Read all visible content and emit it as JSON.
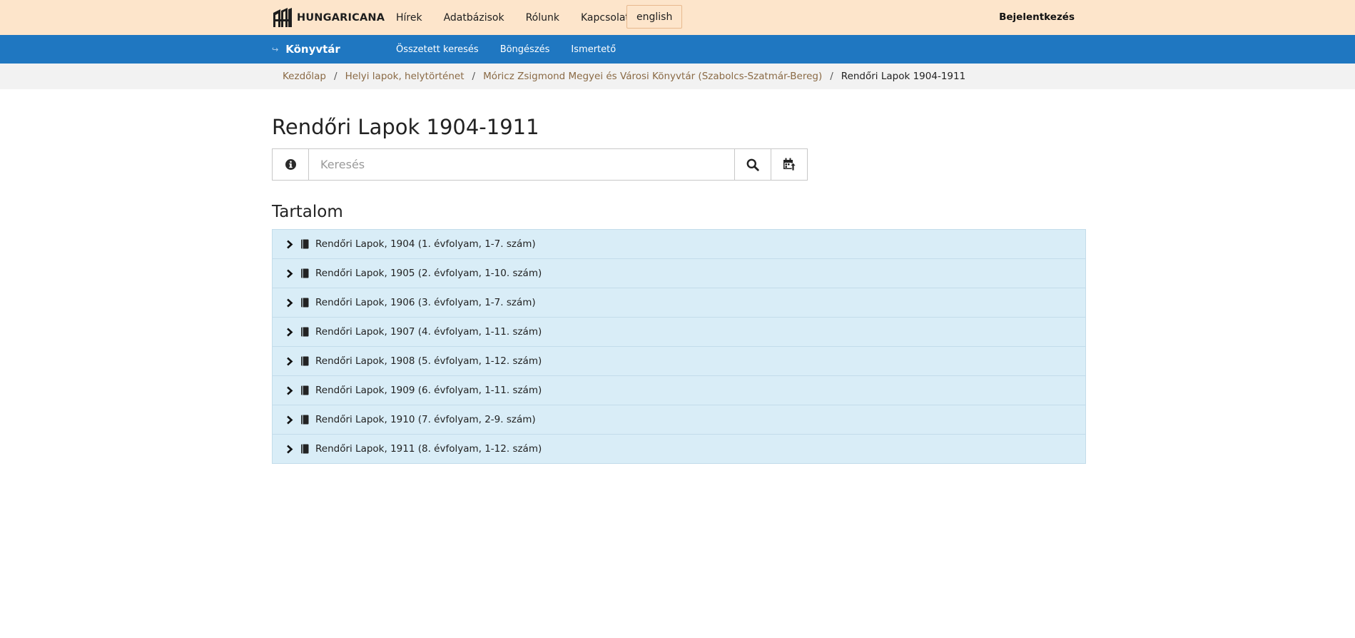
{
  "header": {
    "logo_text": "HUNGARICANA",
    "nav": [
      "Hírek",
      "Adatbázisok",
      "Rólunk",
      "Kapcsolat"
    ],
    "language_button": "english",
    "login_label": "Bejelentkezés"
  },
  "subheader": {
    "section_title": "Könyvtár",
    "section_icon": "sign-in-icon",
    "nav": [
      "Összetett keresés",
      "Böngészés",
      "Ismertető"
    ]
  },
  "breadcrumb": {
    "items": [
      "Kezdőlap",
      "Helyi lapok, helytörténet",
      "Móricz Zsigmond Megyei és Városi Könyvtár (Szabolcs-Szatmár-Bereg)"
    ],
    "separator": "/",
    "current": "Rendőri Lapok 1904-1911"
  },
  "page": {
    "title": "Rendőri Lapok 1904-1911"
  },
  "search": {
    "placeholder": "Keresés",
    "value": "",
    "icons": [
      "info-circle-icon",
      "search-icon",
      "export-calendar-icon"
    ]
  },
  "content": {
    "heading": "Tartalom",
    "items": [
      {
        "label": "Rendőri Lapok, 1904 (1. évfolyam, 1-7. szám)"
      },
      {
        "label": "Rendőri Lapok, 1905 (2. évfolyam, 1-10. szám)"
      },
      {
        "label": "Rendőri Lapok, 1906 (3. évfolyam, 1-7. szám)"
      },
      {
        "label": "Rendőri Lapok, 1907 (4. évfolyam, 1-11. szám)"
      },
      {
        "label": "Rendőri Lapok, 1908 (5. évfolyam, 1-12. szám)"
      },
      {
        "label": "Rendőri Lapok, 1909 (6. évfolyam, 1-11. szám)"
      },
      {
        "label": "Rendőri Lapok, 1910 (7. évfolyam, 2-9. szám)"
      },
      {
        "label": "Rendőri Lapok, 1911 (8. évfolyam, 1-12. szám)"
      }
    ]
  },
  "colors": {
    "top_bar": "#fde5cb",
    "blue_bar": "#1f77c1",
    "breadcrumb_bar": "#f2f2f2",
    "breadcrumb_link": "#8a6a45",
    "tree_background": "#d9edf7",
    "tree_border": "#c3dcea"
  }
}
